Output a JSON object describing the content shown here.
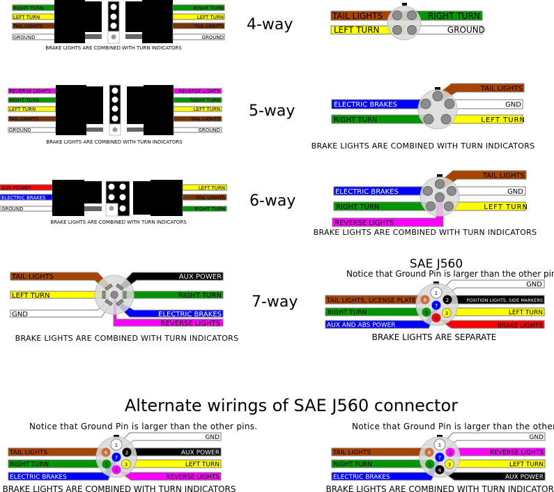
{
  "colors": {
    "green": "#009600",
    "yellow": "#ffff00",
    "brown": "#a84300",
    "dark_brown": "#7a3300",
    "blue": "#0000ff",
    "magenta": "#ff00ff",
    "red": "#ff0000",
    "black": "#000000",
    "white": "#ffffff"
  },
  "four_way": {
    "label": "4-way",
    "flat": {
      "left": [
        "RIGHT TURN",
        "LEFT TURN",
        "TAIL LIGHTS",
        "GROUND"
      ],
      "right": [
        "RIGHT TURN",
        "LEFT TURN",
        "TAIL LIGHTS",
        "GROUND"
      ],
      "caption": "BRAKE LIGHTS ARE COMBINED WITH TURN INDICATORS"
    },
    "round": {
      "tail": "TAIL LIGHTS",
      "right_turn": "RIGHT TURN",
      "left_turn": "LEFT TURN",
      "ground": "GROUND"
    }
  },
  "five_way": {
    "label": "5-way",
    "flat": {
      "left": [
        "REVERSE LIGHTS",
        "RIGHT TURN",
        "LEFT TURN",
        "TAIL LIGHTS",
        "GROUND"
      ],
      "right": [
        "REVERSE LIGHTS",
        "RIGHT TURN",
        "LEFT TURN",
        "TAIL LIGHTS",
        "GROUND"
      ],
      "caption": "BRAKE LIGHTS ARE COMBINED WITH TURN INDICATORS"
    },
    "round": {
      "tail": "TAIL LIGHTS",
      "brakes": "ELECTRIC BRAKES",
      "gnd": "GND",
      "right_turn": "RIGHT TURN",
      "left_turn": "LEFT TURN",
      "caption": "BRAKE LIGHTS ARE COMBINED WITH TURN INDICATORS"
    }
  },
  "six_way": {
    "label": "6-way",
    "flat": {
      "left": [
        "AUX POWER",
        "ELECTRIC BRAKES",
        "GROUND"
      ],
      "right": [
        "LEFT TURN",
        "TAIL LIGHTS",
        "RIGHT TURN"
      ],
      "caption": "BRAKE LIGHTS ARE COMBINED WITH TURN INDICATORS"
    },
    "round": {
      "tail": "TAIL LIGHTS",
      "brakes": "ELECTRIC BRAKES",
      "gnd": "GND",
      "right_turn": "RIGHT TURN",
      "left_turn": "LEFT TURN",
      "reverse": "REVERSE LIGHTS",
      "caption": "BRAKE LIGHTS ARE COMBINED WITH TURN INDICATORS"
    }
  },
  "seven_way": {
    "label": "7-way",
    "tail": "TAIL LIGHTS",
    "aux": "AUX POWER",
    "left_turn": "LEFT TURN",
    "right_turn": "RIGHT TURN",
    "gnd": "GND",
    "brakes": "ELECTRIC BRAKES",
    "reverse": "REVERSE LIGHTS",
    "caption": "BRAKE LIGHTS ARE COMBINED WITH TURN INDICATORS"
  },
  "sae_j560": {
    "title": "SAE J560",
    "notice": "Notice that Ground Pin is larger than the other pins.",
    "gnd": "GND",
    "tail": "TAIL LIGHTS, LICENSE PLATE",
    "position": "POSITION LIGHTS, SIDE MARKERS",
    "right_turn": "RIGHT TURN",
    "left_turn": "LEFT TURN",
    "aux_abs": "AUX AND ABS POWER",
    "brake": "BRAKE LIGHTS",
    "pins": [
      "1",
      "2",
      "3",
      "4",
      "5",
      "6",
      "7"
    ],
    "caption": "BRAKE LIGHTS ARE SEPARATE"
  },
  "alternate": {
    "title": "Alternate wirings of SAE J560 connector",
    "left": {
      "notice": "Notice that Ground Pin is larger than the other pins.",
      "gnd": "GND",
      "tail": "TAIL LIGHTS",
      "aux": "AUX POWER",
      "right_turn": "RIGHT TURN",
      "left_turn": "LEFT TURN",
      "brakes": "ELECTRIC BRAKES",
      "reverse": "REVERSE LIGHTS",
      "caption": "BRAKE LIGHTS ARE COMBINED WITH TURN INDICATORS"
    },
    "right": {
      "notice": "Notice that Ground Pin is larger than the other pins.",
      "gnd": "GND",
      "tail": "TAIL LIGHTS",
      "reverse": "REVERSE LIGHTS",
      "right_turn": "RIGHT TURN",
      "left_turn": "LEFT TURN",
      "brakes": "ELECTRIC BRAKES",
      "aux": "AUX POWER",
      "caption": "BRAKE LIGHTS ARE COMBINED WITH TURN INDICATORS"
    }
  }
}
